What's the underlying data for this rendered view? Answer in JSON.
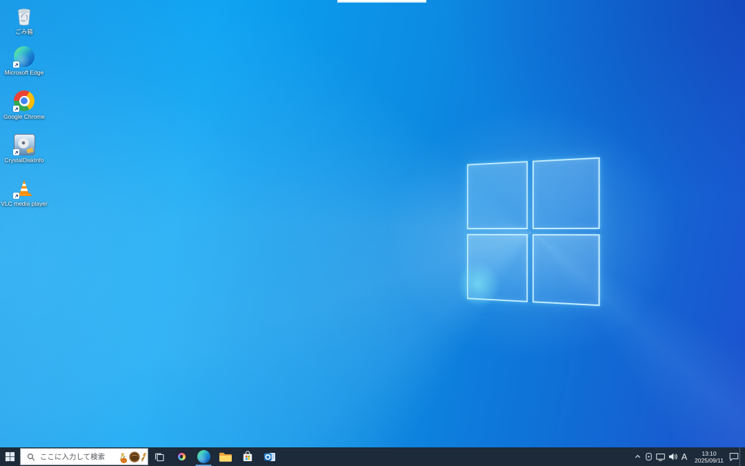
{
  "desktop": {
    "icons": [
      {
        "id": "recycle-bin",
        "label": "ごみ箱"
      },
      {
        "id": "microsoft-edge",
        "label": "Microsoft Edge"
      },
      {
        "id": "google-chrome",
        "label": "Google Chrome"
      },
      {
        "id": "crystaldiskinfo",
        "label": "CrystalDiskInfo"
      },
      {
        "id": "vlc-media-player",
        "label": "VLC media player"
      }
    ]
  },
  "taskbar": {
    "search": {
      "placeholder": "ここに入力して検索",
      "decoration": "search-highlights-autumn-illustration"
    },
    "pinned": [
      "task-view",
      "copilot",
      "microsoft-edge",
      "file-explorer",
      "microsoft-store",
      "outlook"
    ],
    "running_apps": [
      "microsoft-edge"
    ],
    "tray": {
      "hidden_icons_button": "chevron-up-icon",
      "icons": [
        "tray-app-icon",
        "ethernet-network-icon",
        "volume-icon"
      ],
      "ime_mode": "A",
      "clock": {
        "time": "13:10",
        "date": "2025/09/11"
      },
      "action_center": "action-center-icon"
    },
    "colors": {
      "taskbar_bg": "#1c2a39",
      "running_underline": "#5e9fd8",
      "search_bg": "#ffffff"
    }
  },
  "wallpaper": {
    "name": "windows-10-default-light",
    "colors": {
      "bright_left": "#0aa9f4",
      "mid_azure": "#0c8ce2",
      "deep_right": "#1c51ce"
    }
  }
}
